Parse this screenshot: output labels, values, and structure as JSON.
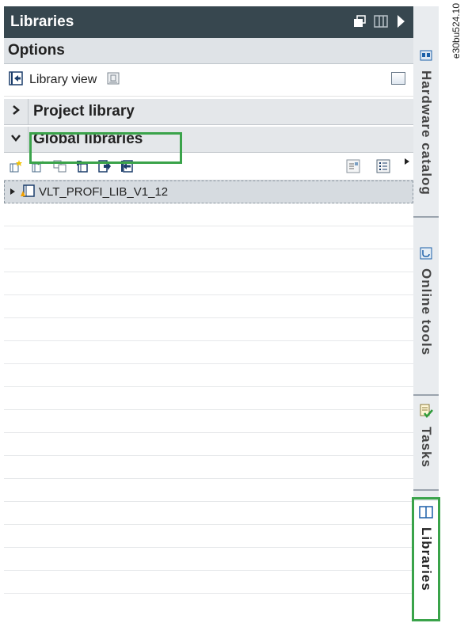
{
  "panel": {
    "title": "Libraries",
    "options_label": "Options",
    "library_view_label": "Library view",
    "sections": {
      "project_library": "Project library",
      "global_libraries": "Global libraries"
    },
    "tree_items": [
      "VLT_PROFI_LIB_V1_12"
    ]
  },
  "sidebar": {
    "tabs": [
      {
        "label": "Hardware catalog",
        "icon": "hardware-catalog-icon",
        "active": false
      },
      {
        "label": "Online tools",
        "icon": "online-tools-icon",
        "active": false
      },
      {
        "label": "Tasks",
        "icon": "tasks-icon",
        "active": false
      },
      {
        "label": "Libraries",
        "icon": "libraries-icon",
        "active": true
      }
    ]
  },
  "doc_id": "e30bu524.10",
  "colors": {
    "title_bg": "#37474f",
    "highlight": "#3aa34a",
    "section_bg": "#e4e7ea",
    "selected_row": "#d6dbe0"
  }
}
